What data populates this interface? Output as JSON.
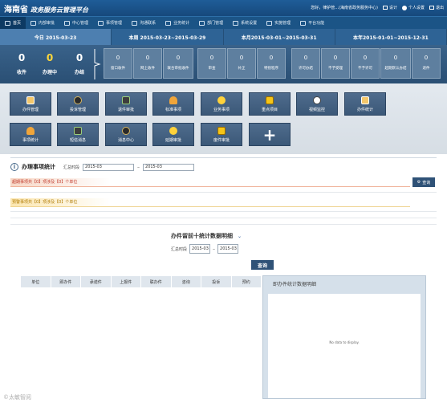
{
  "header": {
    "logo_province": "海南省",
    "logo_title": "政务服务云管理平台",
    "greeting": "您好，律护管...(海南省政务服务中心)",
    "design": "设计",
    "personal": "个人设置",
    "logout": "退出"
  },
  "nav": [
    {
      "label": "首页"
    },
    {
      "label": "内部审批"
    },
    {
      "label": "中心管理"
    },
    {
      "label": "事项管理"
    },
    {
      "label": "沟通联系"
    },
    {
      "label": "业务统计"
    },
    {
      "label": "部门管理"
    },
    {
      "label": "系统设置"
    },
    {
      "label": "实施管理"
    },
    {
      "label": "平台功能"
    }
  ],
  "date_tabs": [
    {
      "label": "今日 2015-03-23"
    },
    {
      "label": "本周 2015-03-23~2015-03-29"
    },
    {
      "label": "本月2015-03-01~2015-03-31"
    },
    {
      "label": "本年2015-01-01~2015-12-31"
    }
  ],
  "big_stats": [
    {
      "value": "0",
      "label": "收件"
    },
    {
      "value": "0",
      "label": "办理中"
    },
    {
      "value": "0",
      "label": "办结"
    }
  ],
  "small_stats": [
    {
      "value": "0",
      "label": "窗口收件"
    },
    {
      "value": "0",
      "label": "网上收件"
    },
    {
      "value": "0",
      "label": "联合审批收件"
    },
    {
      "value": "0",
      "label": "审查"
    },
    {
      "value": "0",
      "label": "补正"
    },
    {
      "value": "0",
      "label": "特别程序"
    },
    {
      "value": "0",
      "label": "许可办结"
    },
    {
      "value": "0",
      "label": "不予受理"
    },
    {
      "value": "0",
      "label": "不予许可"
    },
    {
      "value": "0",
      "label": "超期默认办结"
    },
    {
      "value": "0",
      "label": "退件"
    }
  ],
  "tiles": [
    {
      "label": "办件管理",
      "icon": "clipboard-icon"
    },
    {
      "label": "投诉管理",
      "icon": "gear-icon"
    },
    {
      "label": "退件审批",
      "icon": "screen-icon"
    },
    {
      "label": "标准事项",
      "icon": "stamp-icon"
    },
    {
      "label": "业务事项",
      "icon": "bulb-icon"
    },
    {
      "label": "重点项目",
      "icon": "warning-icon"
    },
    {
      "label": "视频监控",
      "icon": "clock-icon"
    },
    {
      "label": "办件统计",
      "icon": "clipboard-icon"
    },
    {
      "label": "事项统计",
      "icon": "stamp-icon"
    },
    {
      "label": "短信消息",
      "icon": "screen-icon"
    },
    {
      "label": "消息中心",
      "icon": "gear-icon"
    },
    {
      "label": "延期审批",
      "icon": "bulb-icon"
    },
    {
      "label": "废件审批",
      "icon": "warning-icon"
    },
    {
      "label": "",
      "icon": "plus-icon"
    }
  ],
  "section": {
    "title": "办理事项统计",
    "range_label": "汇总时段",
    "date_from": "2015-03",
    "date_to": "2015-03",
    "alert_red": "超期事项共【0】项涉及【0】个单位",
    "alert_yellow": "预警事项共【0】项涉及【0】个单位",
    "query_top": "查询"
  },
  "subsection": {
    "title": "办件留前十统计数据明细",
    "range_label": "汇总时段",
    "date_from": "2015-03",
    "date_to": "2015-03",
    "query": "查询"
  },
  "table": {
    "columns": [
      "单位",
      "即办件",
      "承诺件",
      "上报件",
      "联办件",
      "咨询",
      "投诉",
      "预约"
    ]
  },
  "chart_panel": {
    "title": "即办件统计数据明细",
    "nodata": "No data to display."
  },
  "watermark": "©太敏智阅"
}
